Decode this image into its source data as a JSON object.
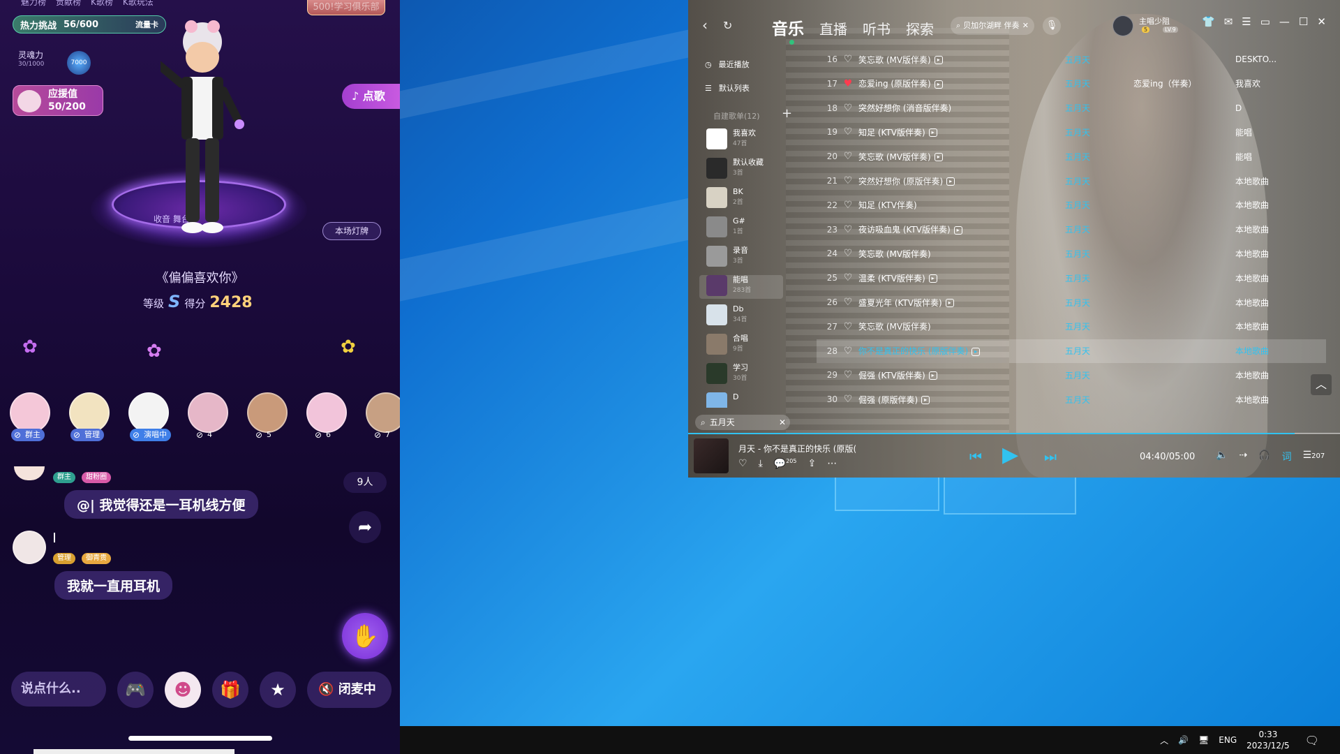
{
  "phone": {
    "top_tabs": [
      "魅力榜",
      "贡献榜",
      "K歌榜",
      "K歌玩法"
    ],
    "heat": {
      "label": "热力挑战",
      "value": "56/600",
      "traffic": "流量卡"
    },
    "soul": {
      "label": "灵魂力",
      "value": "30/1000",
      "orb": "7000"
    },
    "support": {
      "label": "应援值",
      "value": "50/200"
    },
    "top_right": "500!学习俱乐部",
    "sing_label": "♪ 点歌",
    "stage_label": "收音 舞台",
    "light_label": "本场灯牌",
    "song_title": "《偏偏喜欢你》",
    "grade_label": "等级",
    "grade": "S",
    "score_label": "得分",
    "score": "2428",
    "seats": [
      {
        "tag": "群主",
        "color": "#f4c7d8",
        "tagcolor": "#4f6fd8"
      },
      {
        "tag": "管理",
        "color": "#f2e3c0",
        "tagcolor": "#4f6fd8"
      },
      {
        "tag": "演唱中",
        "color": "#f3f3f3",
        "tagcolor": "#3f7fe8"
      },
      {
        "num": "4",
        "color": "#e6b7c8"
      },
      {
        "num": "5",
        "color": "#c99a7a"
      },
      {
        "num": "6",
        "color": "#f2c4da"
      },
      {
        "num": "7",
        "color": "#c7a083"
      }
    ],
    "chat_count": "9人",
    "chat1_badges": [
      "群主",
      "甜粉圈"
    ],
    "chat1_text": "@| 我觉得还是一耳机线方便",
    "chat2_badges": [
      "管理",
      "御青贵"
    ],
    "chat2_text": "我就一直用耳机",
    "input_placeholder": "说点什么..",
    "mic_label": "闭麦中"
  },
  "music": {
    "tabs": [
      "音乐",
      "直播",
      "听书",
      "探索"
    ],
    "search_text": "贝加尔湖畔 伴奏",
    "user_name": "主唱少阻",
    "user_level": "5",
    "user_level2": "LV.9",
    "sidebar": {
      "recent": "最近播放",
      "default_list": "默认列表",
      "section": "自建歌单(12)",
      "playlists": [
        {
          "name": "我喜欢",
          "count": "47首",
          "color": "#ffffff"
        },
        {
          "name": "默认收藏",
          "count": "3首",
          "color": "#2a2a2a"
        },
        {
          "name": "BK",
          "count": "2首",
          "color": "#d8d2c4"
        },
        {
          "name": "G#",
          "count": "1首",
          "color": "#8a8a8a"
        },
        {
          "name": "录音",
          "count": "3首",
          "color": "#9a9a9a"
        },
        {
          "name": "能唱",
          "count": "283首",
          "color": "#5a3a6a"
        },
        {
          "name": "Db",
          "count": "34首",
          "color": "#d8e2ea"
        },
        {
          "name": "合唱",
          "count": "9首",
          "color": "#8a7a6a"
        },
        {
          "name": "学习",
          "count": "30首",
          "color": "#2a3a2a"
        },
        {
          "name": "D",
          "count": "",
          "color": "#7fb6e8"
        }
      ],
      "search_text": "五月天"
    },
    "tracks": [
      {
        "no": "16",
        "title": "笑忘歌 (MV版伴奏)",
        "mv": true,
        "artist": "五月天",
        "album": "",
        "source": "DESKTO...",
        "liked": false
      },
      {
        "no": "17",
        "title": "恋爱ing (原版伴奏)",
        "mv": true,
        "artist": "五月天",
        "album": "恋爱ing（伴奏）",
        "source": "我喜欢",
        "liked": true
      },
      {
        "no": "18",
        "title": "突然好想你 (消音版伴奏)",
        "mv": false,
        "artist": "五月天",
        "album": "",
        "source": "D",
        "liked": false
      },
      {
        "no": "19",
        "title": "知足 (KTV版伴奏)",
        "mv": true,
        "artist": "五月天",
        "album": "",
        "source": "能唱",
        "liked": false
      },
      {
        "no": "20",
        "title": "笑忘歌 (MV版伴奏)",
        "mv": true,
        "artist": "五月天",
        "album": "",
        "source": "能唱",
        "liked": false
      },
      {
        "no": "21",
        "title": "突然好想你 (原版伴奏)",
        "mv": true,
        "artist": "五月天",
        "album": "",
        "source": "本地歌曲",
        "liked": false
      },
      {
        "no": "22",
        "title": "知足 (KTV伴奏)",
        "mv": false,
        "artist": "五月天",
        "album": "",
        "source": "本地歌曲",
        "liked": false
      },
      {
        "no": "23",
        "title": "夜访吸血鬼 (KTV版伴奏)",
        "mv": true,
        "artist": "五月天",
        "album": "",
        "source": "本地歌曲",
        "liked": false
      },
      {
        "no": "24",
        "title": "笑忘歌 (MV版伴奏)",
        "mv": false,
        "artist": "五月天",
        "album": "",
        "source": "本地歌曲",
        "liked": false
      },
      {
        "no": "25",
        "title": "温柔 (KTV版伴奏)",
        "mv": true,
        "artist": "五月天",
        "album": "",
        "source": "本地歌曲",
        "liked": false
      },
      {
        "no": "26",
        "title": "盛夏光年 (KTV版伴奏)",
        "mv": true,
        "artist": "五月天",
        "album": "",
        "source": "本地歌曲",
        "liked": false
      },
      {
        "no": "27",
        "title": "笑忘歌 (MV版伴奏)",
        "mv": false,
        "artist": "五月天",
        "album": "",
        "source": "本地歌曲",
        "liked": false
      },
      {
        "no": "28",
        "title": "你不是真正的快乐 (原版伴奏)",
        "mv": true,
        "artist": "五月天",
        "album": "",
        "source": "本地歌曲",
        "liked": false,
        "playing": true
      },
      {
        "no": "29",
        "title": "倔强 (KTV版伴奏)",
        "mv": true,
        "artist": "五月天",
        "album": "",
        "source": "本地歌曲",
        "liked": false
      },
      {
        "no": "30",
        "title": "倔强 (原版伴奏)",
        "mv": true,
        "artist": "五月天",
        "album": "",
        "source": "本地歌曲",
        "liked": false
      }
    ],
    "now_playing": "月天 - 你不是真正的快乐 (原版(",
    "like_count": "205",
    "time": "04:40/05:00",
    "progress": 0.93,
    "playlist_count": "207"
  },
  "taskbar": {
    "lang": "ENG",
    "time": "0:33",
    "date": "2023/12/5"
  }
}
